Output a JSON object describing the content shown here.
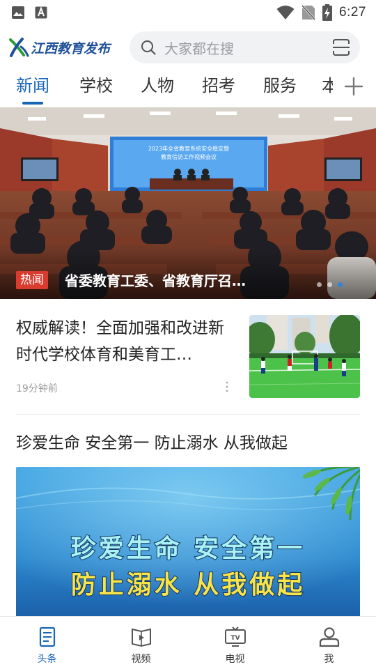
{
  "status_bar": {
    "time": "6:27",
    "icons": [
      "image-icon",
      "text-a-icon",
      "wifi-icon",
      "no-sim-icon",
      "battery-charging-icon"
    ]
  },
  "header": {
    "logo_text": "江西教育发布",
    "search": {
      "placeholder": "大家都在搜"
    }
  },
  "tabs": [
    {
      "label": "新闻",
      "active": true
    },
    {
      "label": "学校",
      "active": false
    },
    {
      "label": "人物",
      "active": false
    },
    {
      "label": "招考",
      "active": false
    },
    {
      "label": "服务",
      "active": false
    }
  ],
  "tab_overflow_label": "本",
  "banner": {
    "tag": "热闻",
    "title": "省委教育工委、省教育厅召…",
    "screen_line1": "2023年全省教育系统安全稳定暨",
    "screen_line2": "教育信访工作视频会议",
    "slide_count": 3,
    "active_slide": 3
  },
  "articles": [
    {
      "title": "权威解读！全面加强和改进新时代学校体育和美育工…",
      "time": "19分钟前"
    },
    {
      "title": "珍爱生命 安全第一 防止溺水 从我做起",
      "image_line1": "珍爱生命  安全第一",
      "image_line2": "防止溺水  从我做起"
    }
  ],
  "bottom_nav": [
    {
      "label": "头条",
      "icon": "news-icon",
      "active": true
    },
    {
      "label": "视频",
      "icon": "video-book-icon",
      "active": false
    },
    {
      "label": "电视",
      "icon": "tv-icon",
      "active": false
    },
    {
      "label": "我",
      "icon": "person-icon",
      "active": false
    }
  ],
  "colors": {
    "accent": "#1765b5",
    "hot_tag": "#d93b2e",
    "logo": "#1e4f9a",
    "search_bg": "#f1f2f4"
  }
}
